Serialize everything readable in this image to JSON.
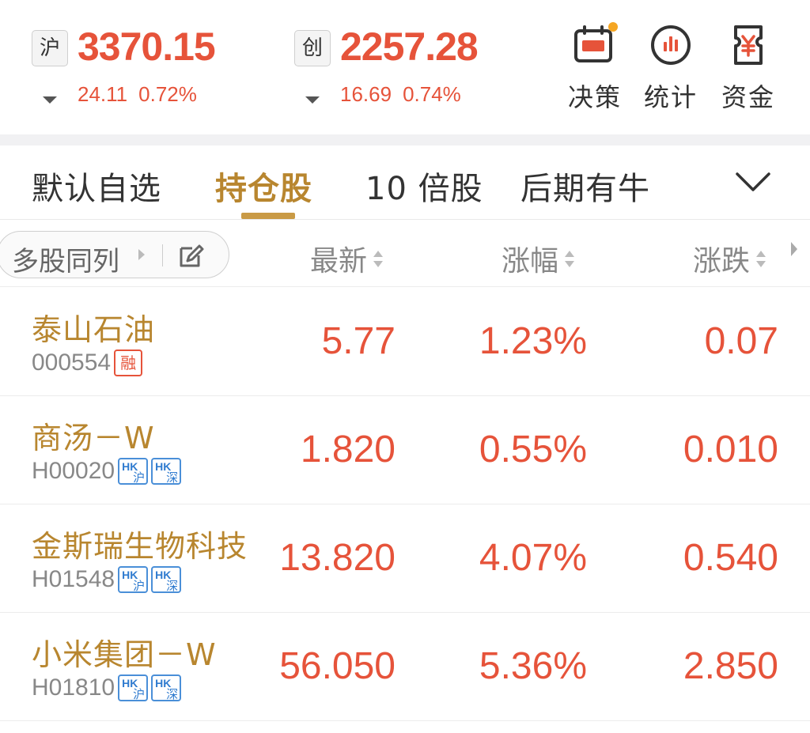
{
  "indices": [
    {
      "market": "沪",
      "value": "3370.15",
      "change": "24.11",
      "percent": "0.72%"
    },
    {
      "market": "创",
      "value": "2257.28",
      "change": "16.69",
      "percent": "0.74%"
    }
  ],
  "tools": [
    {
      "label": "决策",
      "icon": "calendar-decision-icon",
      "has_dot": true
    },
    {
      "label": "统计",
      "icon": "bar-chart-circle-icon",
      "has_dot": false
    },
    {
      "label": "资金",
      "icon": "yen-money-icon",
      "has_dot": false
    }
  ],
  "tabs": [
    {
      "label": "默认自选",
      "active": false
    },
    {
      "label": "持仓股",
      "active": true
    },
    {
      "label": "10 倍股",
      "active": false
    },
    {
      "label": "后期有牛",
      "active": false
    }
  ],
  "column_header": {
    "multi_stock_label": "多股同列",
    "latest": "最新",
    "change_pct": "涨幅",
    "change_amt": "涨跌"
  },
  "stocks": [
    {
      "name": "泰山石油",
      "code": "000554",
      "badges": [
        "融"
      ],
      "latest": "5.77",
      "change_pct": "1.23%",
      "change_amt": "0.07"
    },
    {
      "name": "商汤－W",
      "code": "H00020",
      "badges": [
        "沪",
        "深"
      ],
      "latest": "1.820",
      "change_pct": "0.55%",
      "change_amt": "0.010"
    },
    {
      "name": "金斯瑞生物科技",
      "code": "H01548",
      "badges": [
        "沪",
        "深"
      ],
      "latest": "13.820",
      "change_pct": "4.07%",
      "change_amt": "0.540"
    },
    {
      "name": "小米集团－W",
      "code": "H01810",
      "badges": [
        "沪",
        "深"
      ],
      "latest": "56.050",
      "change_pct": "5.36%",
      "change_amt": "2.850"
    }
  ],
  "hk_badge_prefix": "HK",
  "colors": {
    "up": "#e6533a",
    "gold": "#b8862f",
    "hk_blue": "#2f7bcf"
  }
}
